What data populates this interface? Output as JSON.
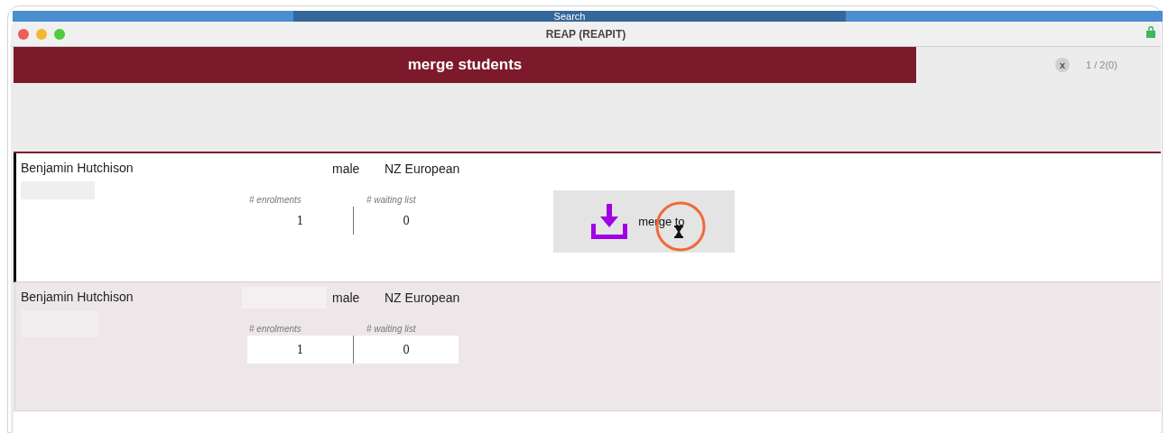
{
  "background_window": {
    "search_label": "Search"
  },
  "window": {
    "title": "REAP (REAPIT)"
  },
  "header": {
    "title": "merge students",
    "close_label": "x",
    "counter": "1 / 2(0)"
  },
  "students": [
    {
      "name": "Benjamin Hutchison",
      "gender": "male",
      "ethnicity": "NZ European",
      "enrolments_label": "# enrolments",
      "enrolments": "1",
      "waiting_label": "# waiting list",
      "waiting": "0",
      "selected": true,
      "merge_button": {
        "label": "merge to"
      }
    },
    {
      "name": "Benjamin Hutchison",
      "gender": "male",
      "ethnicity": "NZ European",
      "enrolments_label": "# enrolments",
      "enrolments": "1",
      "waiting_label": "# waiting list",
      "waiting": "0",
      "selected": false
    }
  ]
}
